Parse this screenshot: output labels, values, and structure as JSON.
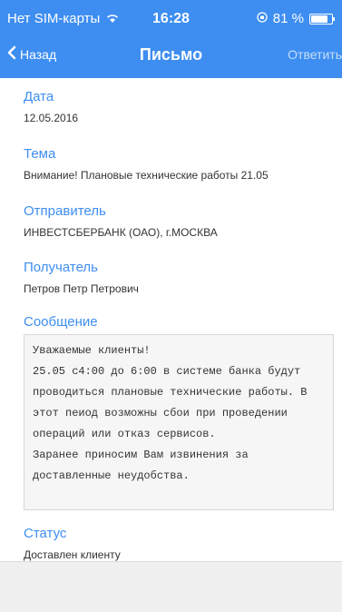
{
  "status_bar": {
    "carrier": "Нет SIM-карты",
    "time": "16:28",
    "battery_percent": "81 %"
  },
  "nav": {
    "back_label": "Назад",
    "title": "Письмо",
    "reply_label": "Ответить"
  },
  "fields": {
    "date": {
      "label": "Дата",
      "value": "12.05.2016"
    },
    "subject": {
      "label": "Тема",
      "value": "Внимание! Плановые технические работы 21.05"
    },
    "sender": {
      "label": "Отправитель",
      "value": "ИНВЕСТСБЕРБАНК (ОАО), г.МОСКВА"
    },
    "recipient": {
      "label": "Получатель",
      "value": "Петров Петр Петрович"
    },
    "message": {
      "label": "Сообщение",
      "lines": [
        "Уважаемые клиенты!",
        "25.05 с4:00 до 6:00 в системе банка будут",
        "проводиться плановые технические работы. В",
        "этот пеиод возможны сбои при проведении",
        "операций или отказ сервисов.",
        "Заранее приносим Вам извинения за",
        "доставленные неудобства."
      ]
    },
    "status": {
      "label": "Статус",
      "value": "Доставлен клиенту"
    }
  },
  "colors": {
    "accent": "#3e8ef1"
  },
  "battery_level": 0.81
}
